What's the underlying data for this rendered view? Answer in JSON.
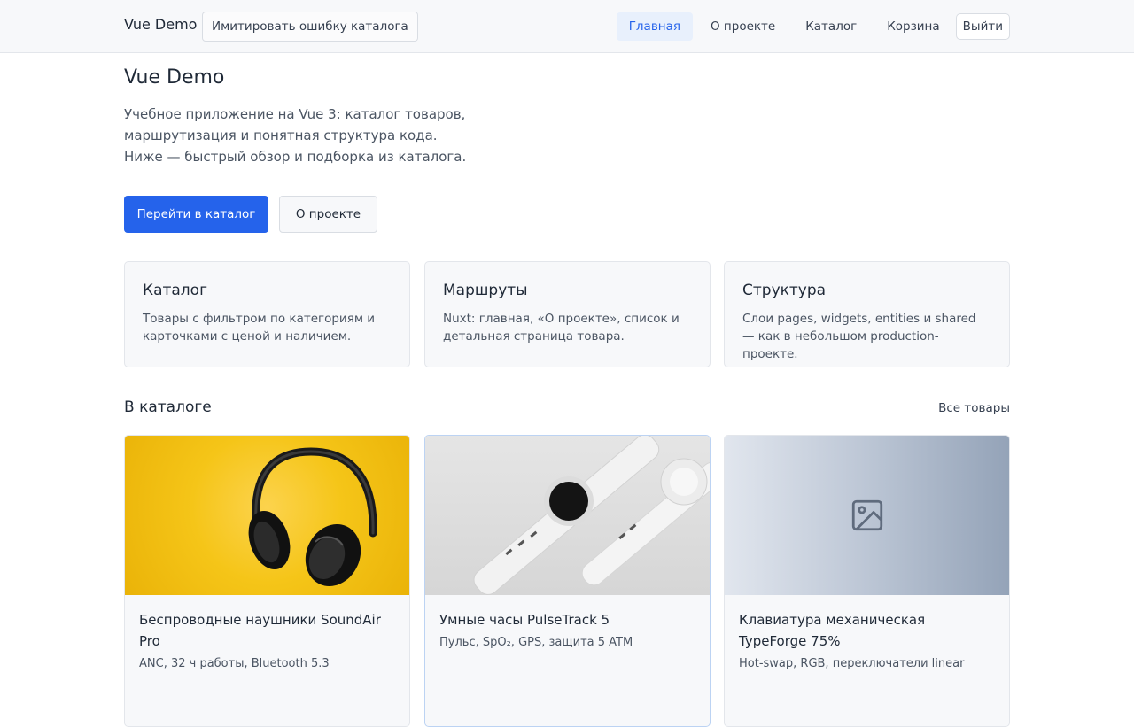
{
  "header": {
    "brand": "Vue Demo",
    "error_button": "Имитировать ошибку каталога",
    "nav": [
      "Главная",
      "О проекте",
      "Каталог",
      "Корзина"
    ],
    "active_nav": "Главная",
    "logout": "Выйти"
  },
  "hero": {
    "title": "Vue Demo",
    "text": "Учебное приложение на Vue 3: каталог товаров, маршрутизация и понятная структура кода. Ниже — быстрый обзор и подборка из каталога.",
    "primary_button": "Перейти в каталог",
    "secondary_button": "О проекте"
  },
  "features": [
    {
      "title": "Каталог",
      "desc": "Товары с фильтром по категориям и карточками с ценой и наличием."
    },
    {
      "title": "Маршруты",
      "desc": "Nuxt: главная, «О проекте», список и детальная страница товара."
    },
    {
      "title": "Структура",
      "desc": "Слои pages, widgets, entities и shared — как в небольшом production-проекте."
    }
  ],
  "catalog": {
    "title": "В каталоге",
    "all_link": "Все товары",
    "products": [
      {
        "name": "Беспроводные наушники SoundAir Pro",
        "desc": "ANC, 32 ч работы, Bluetooth 5.3",
        "image": "headphones-photo"
      },
      {
        "name": "Умные часы PulseTrack 5",
        "desc": "Пульс, SpO₂, GPS, защита 5 ATM",
        "image": "smartwatch-photo"
      },
      {
        "name": "Клавиатура механическая TypeForge 75%",
        "desc": "Hot-swap, RGB, переключатели linear",
        "image": "image-placeholder-icon"
      }
    ]
  }
}
